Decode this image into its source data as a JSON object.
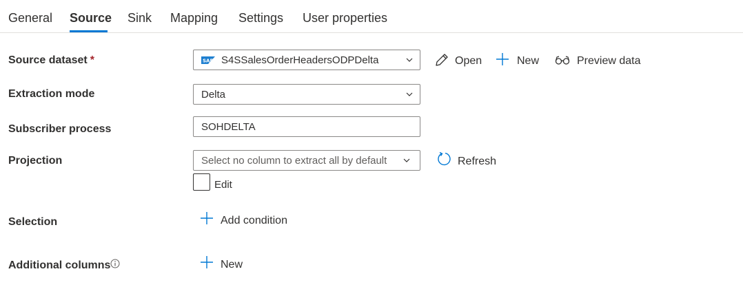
{
  "tabs": [
    {
      "label": "General"
    },
    {
      "label": "Source"
    },
    {
      "label": "Sink"
    },
    {
      "label": "Mapping"
    },
    {
      "label": "Settings"
    },
    {
      "label": "User properties"
    }
  ],
  "active_tab": "Source",
  "accent_color": "#0078d4",
  "form": {
    "source_dataset": {
      "label": "Source dataset",
      "required_mark": "*",
      "value": "S4SSalesOrderHeadersODPDelta",
      "icon": "sap-icon",
      "actions": {
        "open": "Open",
        "new": "New",
        "preview": "Preview data"
      }
    },
    "extraction_mode": {
      "label": "Extraction mode",
      "value": "Delta"
    },
    "subscriber_process": {
      "label": "Subscriber process",
      "value": "SOHDELTA"
    },
    "projection": {
      "label": "Projection",
      "placeholder": "Select no column to extract all by default",
      "refresh": "Refresh",
      "edit_label": "Edit",
      "edit_checked": false
    },
    "selection": {
      "label": "Selection",
      "add_condition": "Add condition"
    },
    "additional_columns": {
      "label": "Additional columns",
      "new": "New"
    }
  }
}
